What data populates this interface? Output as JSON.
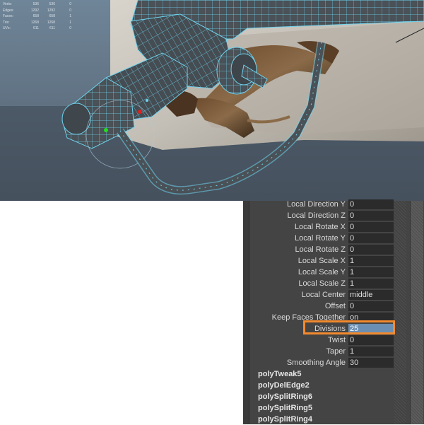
{
  "viewport": {
    "hud": [
      {
        "label": "Verts:",
        "values": [
          "536",
          "536",
          "0"
        ]
      },
      {
        "label": "Edges:",
        "values": [
          "1292",
          "1292",
          "0"
        ]
      },
      {
        "label": "Faces:",
        "values": [
          "658",
          "658",
          "1"
        ]
      },
      {
        "label": "Tris:",
        "values": [
          "1268",
          "1268",
          "1"
        ]
      },
      {
        "label": "UVs:",
        "values": [
          "611",
          "611",
          "0"
        ]
      }
    ]
  },
  "channel_box": {
    "attributes": [
      {
        "label": "Local Direction Y",
        "value": "0"
      },
      {
        "label": "Local Direction Z",
        "value": "0"
      },
      {
        "label": "Local Rotate X",
        "value": "0"
      },
      {
        "label": "Local Rotate Y",
        "value": "0"
      },
      {
        "label": "Local Rotate Z",
        "value": "0"
      },
      {
        "label": "Local Scale X",
        "value": "1"
      },
      {
        "label": "Local Scale Y",
        "value": "1"
      },
      {
        "label": "Local Scale Z",
        "value": "1"
      },
      {
        "label": "Local Center",
        "value": "middle"
      },
      {
        "label": "Offset",
        "value": "0"
      },
      {
        "label": "Keep Faces Together",
        "value": "on"
      },
      {
        "label": "Divisions",
        "value": "25",
        "selected": true
      },
      {
        "label": "Twist",
        "value": "0"
      },
      {
        "label": "Taper",
        "value": "1"
      },
      {
        "label": "Smoothing Angle",
        "value": "30"
      }
    ],
    "nodes": [
      "polyTweak5",
      "polyDelEdge2",
      "polySplitRing6",
      "polySplitRing5",
      "polySplitRing4"
    ],
    "highlight_color": "#f28a2e",
    "selected_color": "#6b8fb2"
  }
}
